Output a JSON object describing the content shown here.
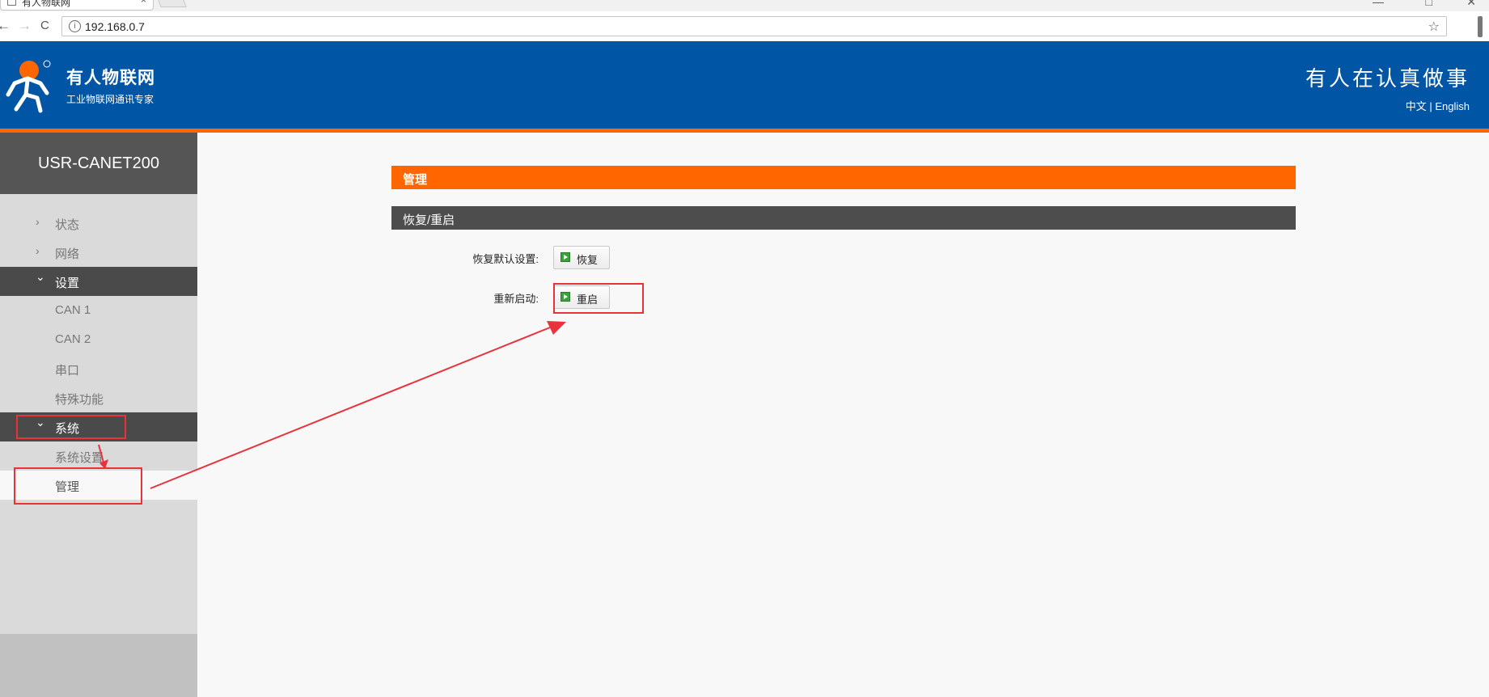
{
  "browser": {
    "tab_title": "有人物联网",
    "tab_close": "×",
    "url": "192.168.0.7",
    "back": "←",
    "forward": "→",
    "reload": "C",
    "bookmark_star": "☆",
    "window_controls": [
      "—",
      "□",
      "✕"
    ]
  },
  "header": {
    "brand_name": "有人物联网",
    "brand_tagline": "工业物联网通讯专家",
    "slogan": "有人在认真做事",
    "lang_cn": "中文",
    "lang_sep": " | ",
    "lang_en": "English",
    "colors": {
      "header_bg": "#0055a5",
      "accent": "#ff6600"
    }
  },
  "sidebar": {
    "device_name": "USR-CANET200",
    "items": [
      {
        "label": "状态",
        "chevron": "›"
      },
      {
        "label": "网络",
        "chevron": "›"
      },
      {
        "label": "设置",
        "chevron": "⌄"
      },
      {
        "label": "CAN 1"
      },
      {
        "label": "CAN 2"
      },
      {
        "label": "串口"
      },
      {
        "label": "特殊功能"
      },
      {
        "label": "系统",
        "chevron": "⌄"
      },
      {
        "label": "系统设置"
      },
      {
        "label": "管理"
      }
    ]
  },
  "main": {
    "section_title": "管理",
    "subsection_title": "恢复/重启",
    "restore_label": "恢复默认设置:",
    "restore_button": "恢复",
    "reboot_label": "重新启动:",
    "reboot_button": "重启"
  },
  "annotation_color": "#e8333a"
}
